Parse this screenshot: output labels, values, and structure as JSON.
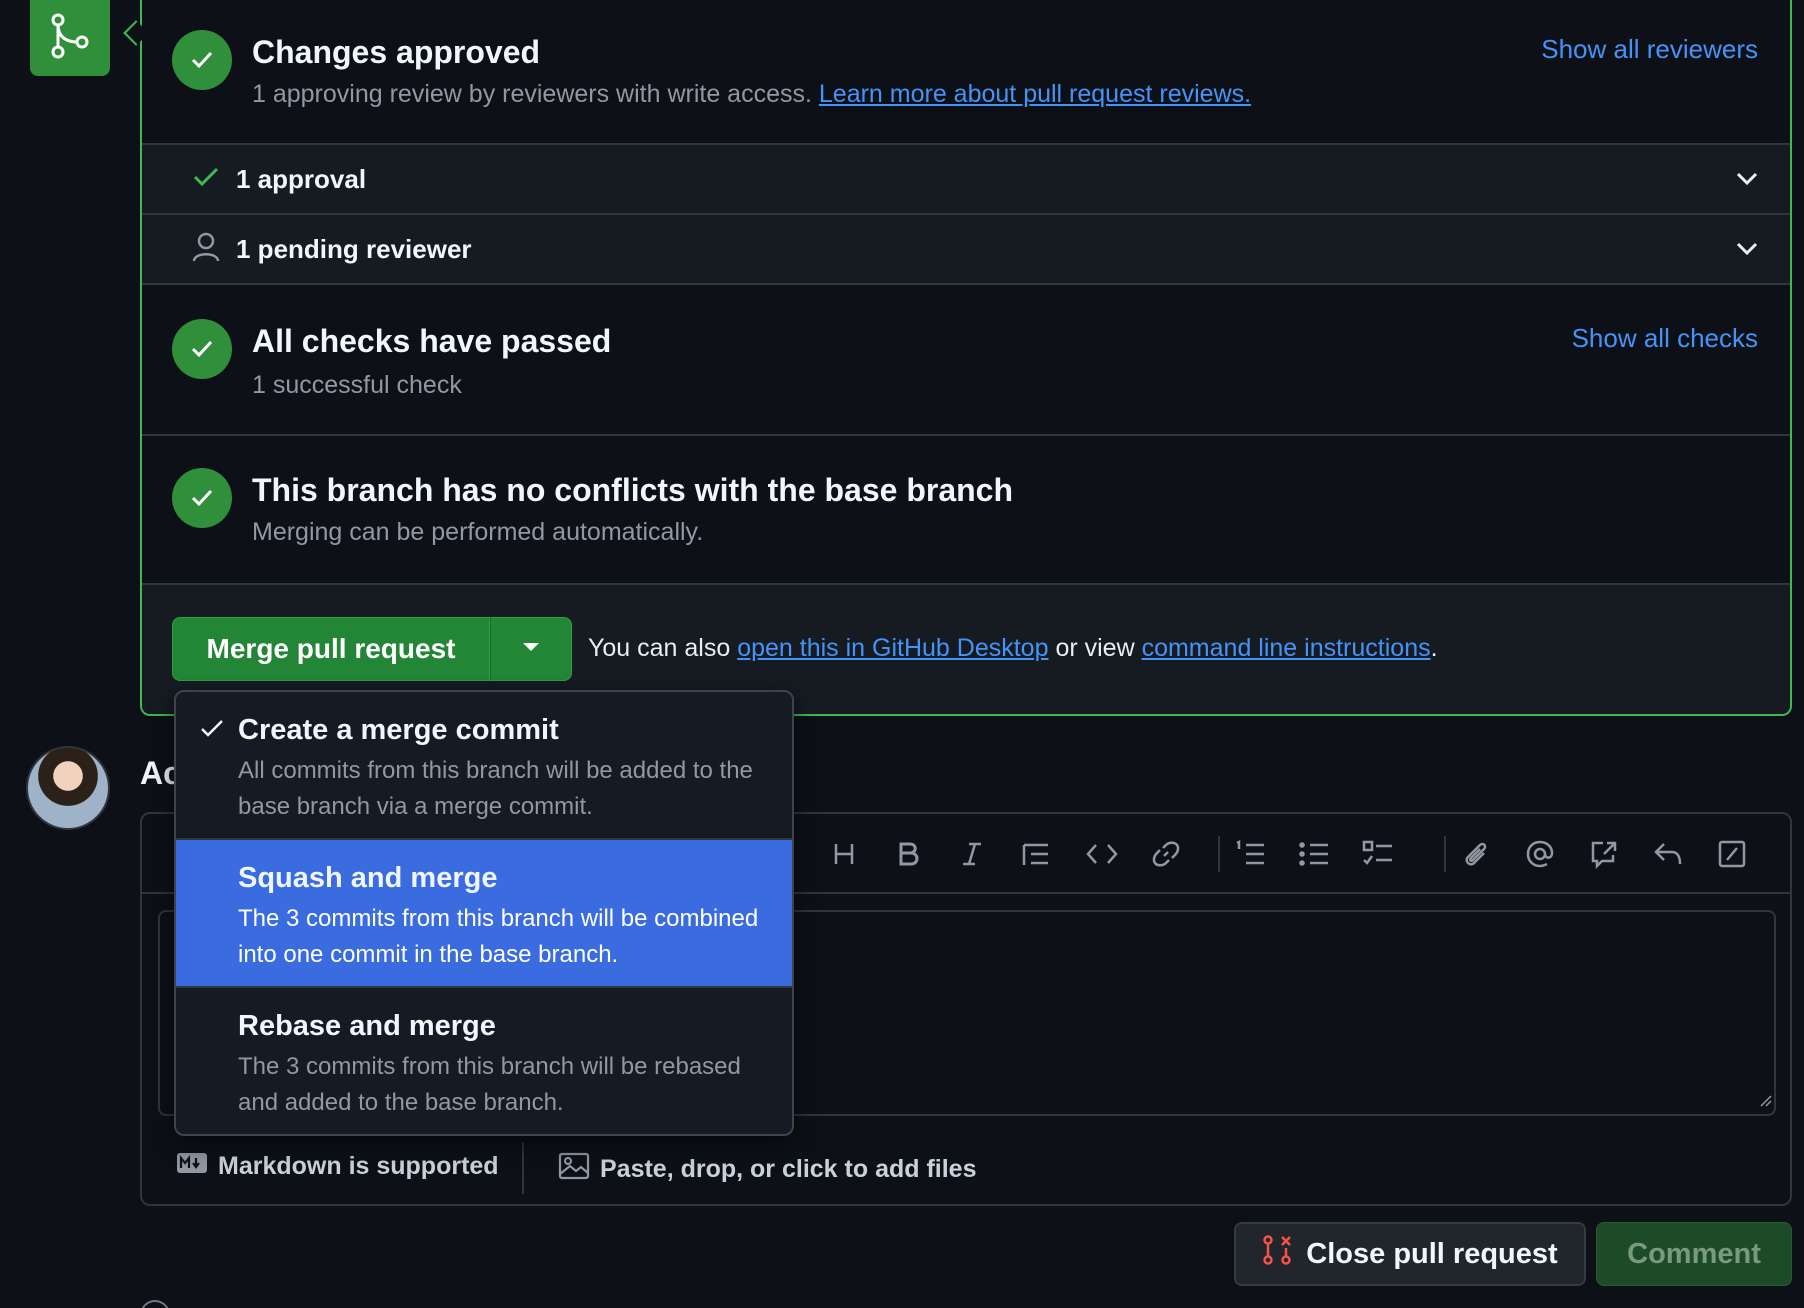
{
  "approved": {
    "title": "Changes approved",
    "subtitle": "1 approving review by reviewers with write access.",
    "learn_link": "Learn more about pull request reviews.",
    "show_all_reviewers": "Show all reviewers"
  },
  "reviews": {
    "approval_label": "1 approval",
    "pending_label": "1 pending reviewer"
  },
  "checks": {
    "title": "All checks have passed",
    "subtitle": "1 successful check",
    "show_all_checks": "Show all checks"
  },
  "conflicts": {
    "title": "This branch has no conflicts with the base branch",
    "subtitle": "Merging can be performed automatically."
  },
  "merge": {
    "button_label": "Merge pull request",
    "also_prefix": "You can also",
    "desktop_link": "open this in GitHub Desktop",
    "or_view": "or view",
    "cli_link": "command line instructions",
    "period": "."
  },
  "merge_menu": {
    "selected_index": 0,
    "highlighted_index": 1,
    "options": [
      {
        "title": "Create a merge commit",
        "description": "All commits from this branch will be added to the base branch via a merge commit."
      },
      {
        "title": "Squash and merge",
        "description": "The 3 commits from this branch will be combined into one commit in the base branch."
      },
      {
        "title": "Rebase and merge",
        "description": "The 3 commits from this branch will be rebased and added to the base branch."
      }
    ]
  },
  "comment": {
    "heading_visible": "Ac",
    "toolbar_icons": [
      "heading-icon",
      "bold-icon",
      "italic-icon",
      "quote-icon",
      "code-icon",
      "link-icon",
      "ordered-list-icon",
      "unordered-list-icon",
      "task-list-icon",
      "attach-icon",
      "mention-icon",
      "cross-reference-icon",
      "reply-icon",
      "slash-command-icon"
    ],
    "markdown_note": "Markdown is supported",
    "files_note": "Paste, drop, or click to add files"
  },
  "actions": {
    "close_label": "Close pull request",
    "comment_label": "Comment"
  },
  "colors": {
    "accent_green": "#238636",
    "success_green": "#3fb950",
    "link_blue": "#4493f8",
    "highlight_blue": "#3a6ce0",
    "danger_red": "#f85149"
  }
}
